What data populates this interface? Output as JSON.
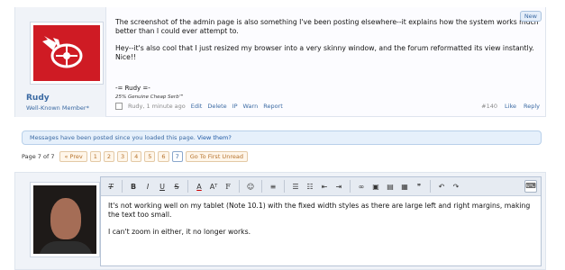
{
  "post": {
    "paragraph1": "The screenshot of the admin page is also something I've been posting elsewhere--it explains how the system works much better than I could ever attempt to.",
    "paragraph2": "Hey--it's also cool that I just resized my browser into a very skinny window, and the forum reformatted its view instantly. Nice!!",
    "signature1": "-= Rudy =-",
    "signature2": "25% Genuine Cheap Serb™",
    "author_name": "Rudy",
    "author_title": "Well-Known Member*",
    "new_badge": "New",
    "meta_author": "Rudy, 1 minute ago",
    "action_edit": "Edit",
    "action_delete": "Delete",
    "action_ip": "IP",
    "action_warn": "Warn",
    "action_report": "Report",
    "post_number": "#140",
    "like": "Like",
    "reply": "Reply"
  },
  "notice": {
    "text": "Messages have been posted since you loaded this page.",
    "link": "View them?"
  },
  "pagination": {
    "label": "Page 7 of 7",
    "prev": "« Prev",
    "pages": [
      "1",
      "2",
      "3",
      "4",
      "5",
      "6",
      "7"
    ],
    "current": "7",
    "first_unread": "Go To First Unread"
  },
  "editor": {
    "paragraph1": "It's not working well on my tablet (Note 10.1) with the fixed width styles as there are large left and right margins, making the text too small.",
    "paragraph2": "I can't zoom in either, it no longer works.",
    "toolbar": [
      "clear-format",
      "bold",
      "italic",
      "underline",
      "strikethrough",
      "text-color",
      "font-size",
      "font-family",
      "smilie",
      "align",
      "bullet-list",
      "numbered-list",
      "outdent",
      "indent",
      "link",
      "image",
      "media",
      "code",
      "quote",
      "undo",
      "redo",
      "toggle-bbcode"
    ]
  },
  "colors": {
    "accent": "#3b6aa3",
    "team_red": "#cf1b24",
    "page_button_bg": "#fff6ea"
  }
}
